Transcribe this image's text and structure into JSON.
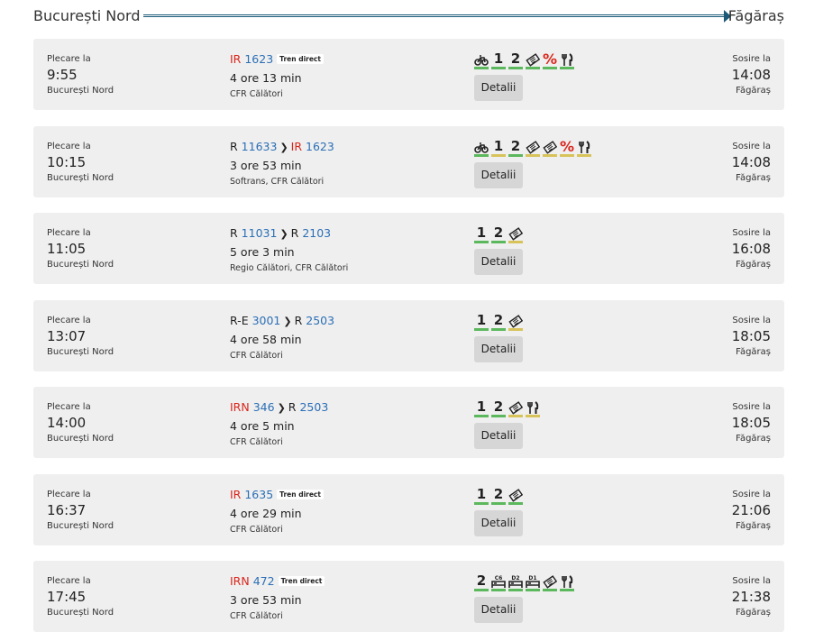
{
  "route": {
    "from": "București Nord",
    "to": "Făgăraș"
  },
  "labels": {
    "departure": "Plecare la",
    "arrival": "Sosire la",
    "details": "Detalii",
    "direct": "Tren direct"
  },
  "trains": [
    {
      "dep_time": "9:55",
      "dep_station": "București Nord",
      "arr_time": "14:08",
      "arr_station": "Făgăraș",
      "segments": [
        {
          "cat": "IR",
          "num": "1623",
          "cat_red": true
        }
      ],
      "direct": true,
      "duration": "4 ore 13 min",
      "operator": "CFR Călători",
      "services": [
        {
          "icon": "bicycle-icon",
          "c": "g"
        },
        {
          "icon": "first-class-icon",
          "text": "1",
          "c": "g"
        },
        {
          "icon": "second-class-icon",
          "text": "2",
          "c": "g"
        },
        {
          "icon": "ticket-icon",
          "c": "g"
        },
        {
          "icon": "discount-icon",
          "text": "%",
          "c": "g"
        },
        {
          "icon": "restaurant-icon",
          "c": "g"
        }
      ]
    },
    {
      "dep_time": "10:15",
      "dep_station": "București Nord",
      "arr_time": "14:08",
      "arr_station": "Făgăraș",
      "segments": [
        {
          "cat": "R",
          "num": "11633",
          "cat_red": false
        },
        {
          "cat": "IR",
          "num": "1623",
          "cat_red": true
        }
      ],
      "direct": false,
      "duration": "3 ore 53 min",
      "operator": "Softrans, CFR Călători",
      "services": [
        {
          "icon": "bicycle-icon",
          "c": "g"
        },
        {
          "icon": "first-class-icon",
          "text": "1",
          "c": "y"
        },
        {
          "icon": "second-class-icon",
          "text": "2",
          "c": "g"
        },
        {
          "icon": "ticket-icon",
          "c": "y"
        },
        {
          "icon": "ticket-icon",
          "c": "y"
        },
        {
          "icon": "discount-icon",
          "text": "%",
          "c": "y"
        },
        {
          "icon": "restaurant-icon",
          "c": "y"
        }
      ]
    },
    {
      "dep_time": "11:05",
      "dep_station": "București Nord",
      "arr_time": "16:08",
      "arr_station": "Făgăraș",
      "segments": [
        {
          "cat": "R",
          "num": "11031",
          "cat_red": false
        },
        {
          "cat": "R",
          "num": "2103",
          "cat_red": false
        }
      ],
      "direct": false,
      "duration": "5 ore 3 min",
      "operator": "Regio Călători, CFR Călători",
      "services": [
        {
          "icon": "first-class-icon",
          "text": "1",
          "c": "g"
        },
        {
          "icon": "second-class-icon",
          "text": "2",
          "c": "g"
        },
        {
          "icon": "ticket-icon",
          "c": "y"
        }
      ]
    },
    {
      "dep_time": "13:07",
      "dep_station": "București Nord",
      "arr_time": "18:05",
      "arr_station": "Făgăraș",
      "segments": [
        {
          "cat": "R-E",
          "num": "3001",
          "cat_red": false
        },
        {
          "cat": "R",
          "num": "2503",
          "cat_red": false
        }
      ],
      "direct": false,
      "duration": "4 ore 58 min",
      "operator": "CFR Călători",
      "services": [
        {
          "icon": "first-class-icon",
          "text": "1",
          "c": "g"
        },
        {
          "icon": "second-class-icon",
          "text": "2",
          "c": "g"
        },
        {
          "icon": "ticket-icon",
          "c": "y"
        }
      ]
    },
    {
      "dep_time": "14:00",
      "dep_station": "București Nord",
      "arr_time": "18:05",
      "arr_station": "Făgăraș",
      "segments": [
        {
          "cat": "IRN",
          "num": "346",
          "cat_red": true
        },
        {
          "cat": "R",
          "num": "2503",
          "cat_red": false
        }
      ],
      "direct": false,
      "duration": "4 ore 5 min",
      "operator": "CFR Călători",
      "services": [
        {
          "icon": "first-class-icon",
          "text": "1",
          "c": "g"
        },
        {
          "icon": "second-class-icon",
          "text": "2",
          "c": "g"
        },
        {
          "icon": "ticket-icon",
          "c": "y"
        },
        {
          "icon": "restaurant-icon",
          "c": "y"
        }
      ]
    },
    {
      "dep_time": "16:37",
      "dep_station": "București Nord",
      "arr_time": "21:06",
      "arr_station": "Făgăraș",
      "segments": [
        {
          "cat": "IR",
          "num": "1635",
          "cat_red": true
        }
      ],
      "direct": true,
      "duration": "4 ore 29 min",
      "operator": "CFR Călători",
      "services": [
        {
          "icon": "first-class-icon",
          "text": "1",
          "c": "g"
        },
        {
          "icon": "second-class-icon",
          "text": "2",
          "c": "g"
        },
        {
          "icon": "ticket-icon",
          "c": "g"
        }
      ]
    },
    {
      "dep_time": "17:45",
      "dep_station": "București Nord",
      "arr_time": "21:38",
      "arr_station": "Făgăraș",
      "segments": [
        {
          "cat": "IRN",
          "num": "472",
          "cat_red": true
        }
      ],
      "direct": true,
      "duration": "3 ore 53 min",
      "operator": "CFR Călători",
      "services": [
        {
          "icon": "second-class-icon",
          "text": "2",
          "c": "g"
        },
        {
          "icon": "couchette-c6-icon",
          "badge": "C6",
          "c": "g"
        },
        {
          "icon": "sleeper-d2-icon",
          "badge": "D2",
          "c": "g"
        },
        {
          "icon": "sleeper-d1-icon",
          "badge": "D1",
          "c": "g"
        },
        {
          "icon": "ticket-icon",
          "c": "g"
        },
        {
          "icon": "restaurant-icon",
          "c": "g"
        }
      ]
    }
  ]
}
